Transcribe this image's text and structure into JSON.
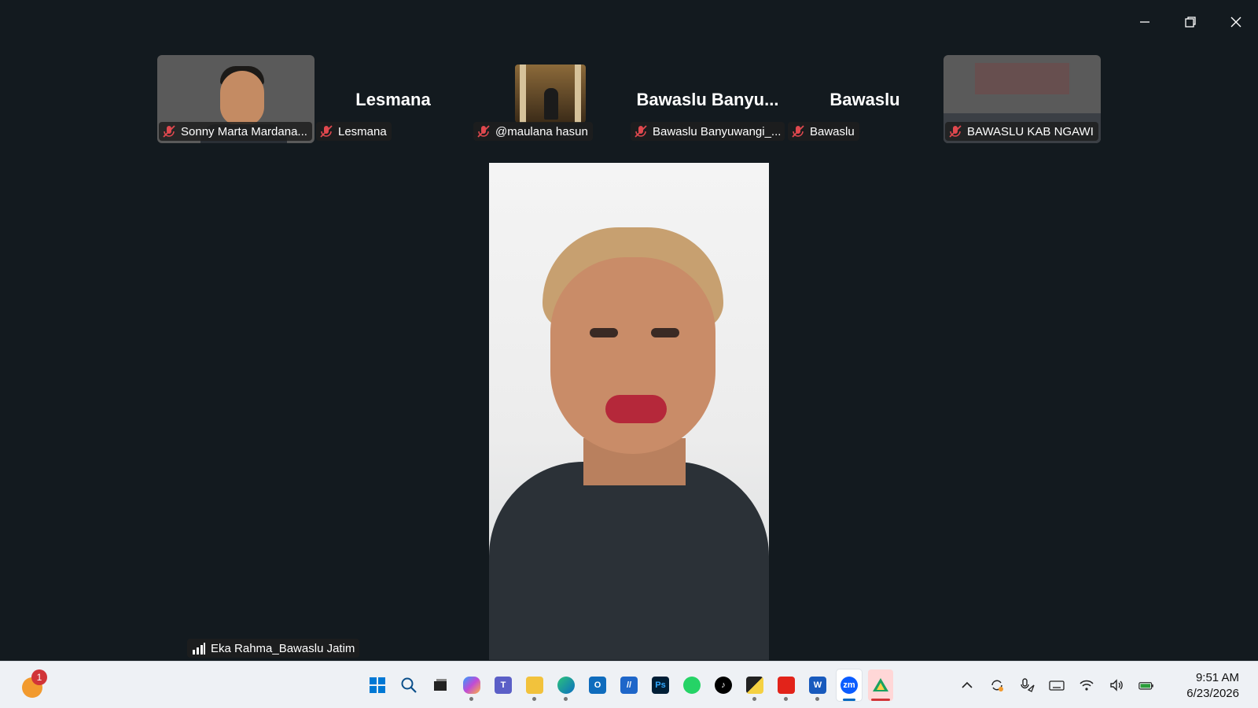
{
  "window": {
    "controls": [
      "minimize",
      "restore",
      "close"
    ]
  },
  "participants": [
    {
      "name_tag": "Sonny Marta Mardana...",
      "big_name": "",
      "video": true
    },
    {
      "name_tag": "Lesmana",
      "big_name": "Lesmana",
      "video": false
    },
    {
      "name_tag": "@maulana hasun",
      "big_name": "",
      "video": true
    },
    {
      "name_tag": "Bawaslu Banyuwangi_...",
      "big_name": "Bawaslu  Banyu...",
      "video": false
    },
    {
      "name_tag": "Bawaslu",
      "big_name": "Bawaslu",
      "video": false
    },
    {
      "name_tag": "BAWASLU KAB NGAWI",
      "big_name": "",
      "video": true
    }
  ],
  "active_speaker": {
    "name": "Eka Rahma_Bawaslu Jatim"
  },
  "taskbar": {
    "notification_badge": "1",
    "apps": [
      {
        "name": "start",
        "icon": "windows-icon"
      },
      {
        "name": "search",
        "icon": "search-icon"
      },
      {
        "name": "task-view",
        "icon": "taskview-icon"
      },
      {
        "name": "copilot",
        "icon": "copilot-icon"
      },
      {
        "name": "teams",
        "icon": "teams-icon"
      },
      {
        "name": "file-explorer",
        "icon": "folder-icon"
      },
      {
        "name": "edge",
        "icon": "edge-icon"
      },
      {
        "name": "outlook",
        "icon": "outlook-icon"
      },
      {
        "name": "app-blue",
        "icon": "app-icon"
      },
      {
        "name": "photoshop",
        "icon": "photoshop-icon",
        "label": "Ps"
      },
      {
        "name": "whatsapp",
        "icon": "whatsapp-icon"
      },
      {
        "name": "tiktok",
        "icon": "tiktok-icon"
      },
      {
        "name": "sticky-notes",
        "icon": "notes-icon"
      },
      {
        "name": "acrobat",
        "icon": "acrobat-icon"
      },
      {
        "name": "word",
        "icon": "word-icon",
        "label": "W"
      },
      {
        "name": "zoom",
        "icon": "zoom-icon",
        "label": "zm"
      },
      {
        "name": "drive",
        "icon": "drive-icon"
      }
    ],
    "clock": {
      "time": "9:51 AM",
      "date": "6/23/2026"
    }
  },
  "colors": {
    "background": "#131a1f",
    "taskbar": "#eef1f5",
    "muted": "#e0484e",
    "accent": "#0067c0"
  }
}
